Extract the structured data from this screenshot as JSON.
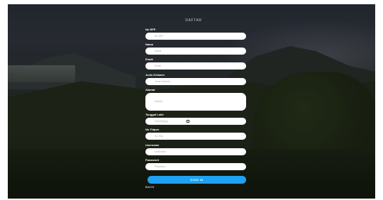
{
  "form": {
    "title": "DAFTAR",
    "fields": [
      {
        "label": "No RFP",
        "placeholder": "No RFP"
      },
      {
        "label": "Nama",
        "placeholder": "Nama"
      },
      {
        "label": "Email",
        "placeholder": "Email"
      },
      {
        "label": "Jenis Kelamin",
        "placeholder": "Jenis Kelamin"
      },
      {
        "label": "Alamat",
        "placeholder": "Alamat"
      },
      {
        "label": "Tanggal Lahir",
        "placeholder": "mm/dd/yyyy"
      },
      {
        "label": "No Telpon",
        "placeholder": "No Telp"
      },
      {
        "label": "Username",
        "placeholder": "Username"
      },
      {
        "label": "Password",
        "placeholder": "Password"
      }
    ],
    "submit_label": "SIGN IN",
    "back_label": "BACK"
  },
  "colors": {
    "submit_bg": "#1ea1f2",
    "input_bg": "#ffffff",
    "label_text": "#ffffff"
  },
  "icons": {
    "date_picker": "calendar-icon"
  }
}
